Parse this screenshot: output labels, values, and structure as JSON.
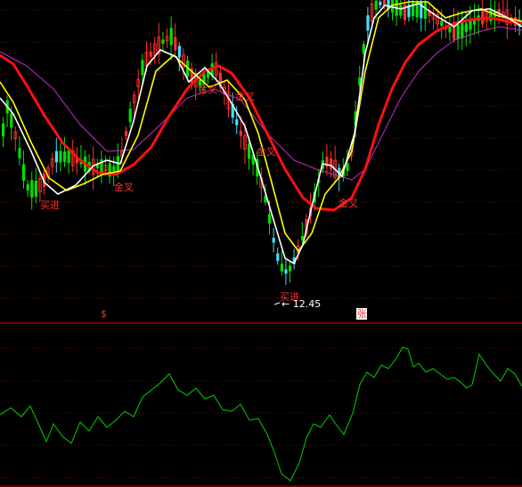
{
  "colors": {
    "background": "#000000",
    "grid": "#7a0000",
    "separator": "#d00000",
    "up_candle": "#ff3030",
    "down_candle": "#00e000",
    "cyan_candle": "#40e0ff",
    "ma_white": "#ffffff",
    "ma_yellow": "#ffff00",
    "ma_magenta": "#c030c0",
    "ma_red": "#ff1010",
    "signal_text": "#ff3030",
    "lower_line": "#00d000"
  },
  "chart_data": [
    {
      "type": "candlestick",
      "panel": "price",
      "annotations": [
        {
          "text": "买进",
          "at_index": 10
        },
        {
          "text": "金叉",
          "at_index": 29
        },
        {
          "text": "金叉",
          "at_index": 55
        },
        {
          "text": "金叉",
          "at_index": 66
        },
        {
          "text": "买进",
          "at_index": 76
        },
        {
          "text": "金叉",
          "at_index": 90
        },
        {
          "text": "金叉",
          "at_index": 120
        }
      ],
      "low_marker": {
        "text": "12.45",
        "at_index": 76
      },
      "series_lines": [
        {
          "color_key": "ma_white"
        },
        {
          "color_key": "ma_yellow"
        },
        {
          "color_key": "ma_magenta"
        },
        {
          "color_key": "ma_red"
        }
      ]
    },
    {
      "type": "line",
      "panel": "indicator",
      "markers": [
        "$",
        "张"
      ]
    }
  ]
}
